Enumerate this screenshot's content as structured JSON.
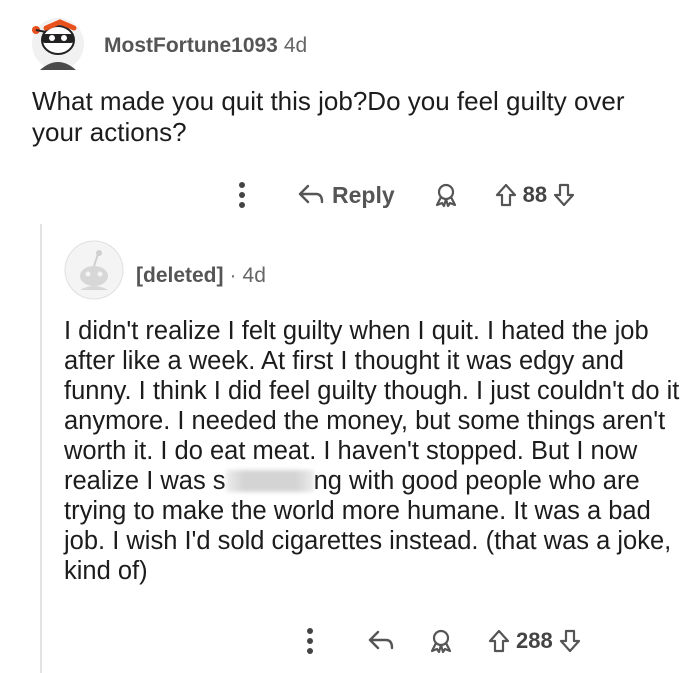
{
  "top_comment": {
    "author": "MostFortune1093",
    "age": "4d",
    "body": "What made you quit this job?Do you feel guilty over your actions?",
    "reply_label": "Reply",
    "score": "88"
  },
  "reply": {
    "author": "[deleted]",
    "separator": "·",
    "age": "4d",
    "body_before_redaction": "I didn't realize I felt guilty when I quit. I hated the job after like a week. At first I thought it was edgy and funny. I think I did feel guilty though. I just couldn't do it anymore. I needed the money, but some things aren't worth it. I do eat meat. I haven't stopped. But I now realize I was s",
    "body_after_redaction": "ng with good people who are trying to make the world more humane. It was a bad job. I wish I'd sold cigarettes instead. (that was a joke, kind of)",
    "score": "288"
  },
  "icons": {
    "more": "more-vertical-icon",
    "reply": "reply-arrow-icon",
    "award": "award-icon",
    "upvote": "upvote-arrow-icon",
    "downvote": "downvote-arrow-icon"
  },
  "colors": {
    "meta_text": "#555555",
    "thread_line": "#e3e3e3"
  }
}
